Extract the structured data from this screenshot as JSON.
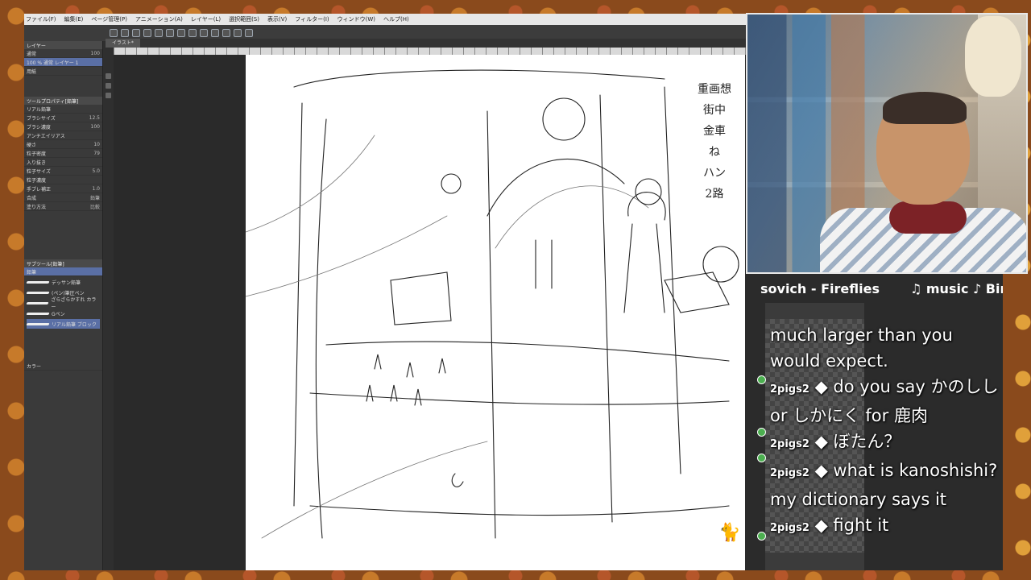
{
  "menubar": {
    "items": [
      "ファイル(F)",
      "編集(E)",
      "ページ管理(P)",
      "アニメーション(A)",
      "レイヤー(L)",
      "選択範囲(S)",
      "表示(V)",
      "フィルター(I)",
      "ウィンドウ(W)",
      "ヘルプ(H)"
    ]
  },
  "document": {
    "tab_label": "イラスト*"
  },
  "layer_panel": {
    "title": "レイヤー",
    "blend_mode": "通常",
    "opacity": "100",
    "layer1": "100 % 通常 レイヤー 1",
    "layer2": "用紙"
  },
  "tool_property": {
    "title": "ツールプロパティ[鉛筆]",
    "brush_name": "リアル鉛筆",
    "rows": [
      {
        "label": "ブラシサイズ",
        "value": "12.5"
      },
      {
        "label": "ブラシ濃度",
        "value": "100"
      },
      {
        "label": "アンチエイリアス",
        "value": ""
      },
      {
        "label": "硬さ",
        "value": "10"
      },
      {
        "label": "粒子密度",
        "value": "79"
      },
      {
        "label": "入り抜き",
        "value": ""
      },
      {
        "label": "粒子サイズ",
        "value": "5.0"
      },
      {
        "label": "粒子濃度",
        "value": ""
      },
      {
        "label": "手ブレ補正",
        "value": "1.0"
      },
      {
        "label": "合成",
        "value": "鉛筆"
      },
      {
        "label": "塗り方法",
        "value": "比較"
      }
    ]
  },
  "subtool_panel": {
    "title": "サブツール[鉛筆]",
    "tab_active": "鉛筆",
    "brushes": [
      "デッサン鉛筆",
      "(ペン)筆圧ペン",
      "ざらざらかすれ カラー",
      "Gペン",
      "リアル鉛筆 ブロック"
    ]
  },
  "color_panel": {
    "label": "カラー"
  },
  "ticker": {
    "left": "sovich - Fireflies",
    "right": "♫ music ♪ Bin"
  },
  "chat": {
    "lines": [
      {
        "user": "",
        "text": "much larger than you would expect."
      },
      {
        "user": "2pigs2",
        "text": "do you say かのしし or しかにく for 鹿肉"
      },
      {
        "user": "2pigs2",
        "text": "ぼたん？"
      },
      {
        "user": "2pigs2",
        "text": "what is kanoshishi? my dictionary says it"
      },
      {
        "user": "2pigs2",
        "text": "fight it"
      }
    ]
  },
  "sketch_annotation": {
    "lines": [
      "重画想",
      "街中",
      "金車",
      "ね",
      "ハン",
      "2路"
    ]
  }
}
